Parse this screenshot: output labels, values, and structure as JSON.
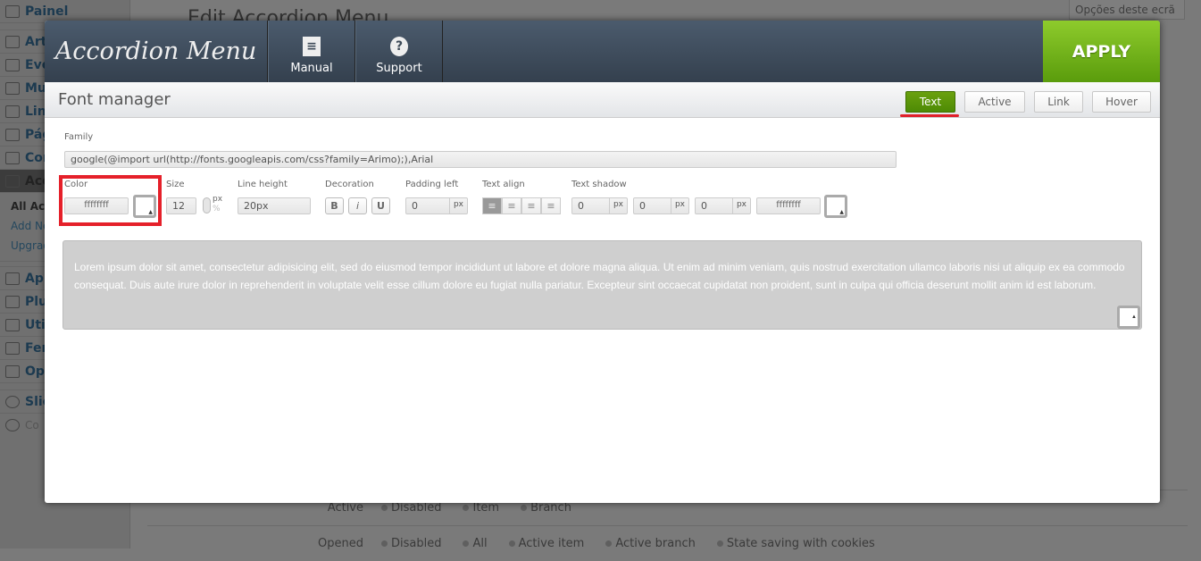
{
  "sidebar": {
    "items": [
      {
        "label": "Painel",
        "icon": "home-icon"
      },
      {
        "label": "Arti",
        "icon": "pin-icon"
      },
      {
        "label": "Eve",
        "icon": "calendar-icon"
      },
      {
        "label": "Mul",
        "icon": "media-icon"
      },
      {
        "label": "Lin",
        "icon": "link-icon"
      },
      {
        "label": "Pág",
        "icon": "pages-icon"
      },
      {
        "label": "Cor",
        "icon": "comments-icon"
      },
      {
        "label": "Acc",
        "icon": "accordion-icon",
        "current": true
      }
    ],
    "subitems": [
      "All Acc",
      "Add Ne",
      "Upgrad"
    ],
    "items2": [
      {
        "label": "Apr",
        "icon": "appearance-icon"
      },
      {
        "label": "Plu",
        "icon": "plugins-icon"
      },
      {
        "label": "Util",
        "icon": "users-icon"
      },
      {
        "label": "Fer",
        "icon": "tools-icon"
      },
      {
        "label": "Opç",
        "icon": "settings-icon"
      },
      {
        "label": "Slic",
        "icon": "gear-icon"
      },
      {
        "label": "Co",
        "icon": "collapse-icon"
      }
    ]
  },
  "page": {
    "title": "Edit Accordion Menu",
    "screen_options": "Opções deste ecrã ▾",
    "rows": [
      {
        "label": "Active",
        "options": [
          "Disabled",
          "Item",
          "Branch"
        ]
      },
      {
        "label": "Opened",
        "options": [
          "Disabled",
          "All",
          "Active item",
          "Active branch",
          "State saving with cookies"
        ]
      }
    ]
  },
  "modal": {
    "logo": "Accordion Menu",
    "manual": "Manual",
    "support": "Support",
    "apply": "APPLY",
    "title": "Font manager",
    "tabs": [
      "Text",
      "Active",
      "Link",
      "Hover"
    ],
    "active_tab": "Text",
    "family_label": "Family",
    "family_value": "google(@import url(http://fonts.googleapis.com/css?family=Arimo);),Arial",
    "color_label": "Color",
    "color_value": "ffffffff",
    "size_label": "Size",
    "size_value": "12",
    "unit_px": "px",
    "unit_pct": "%",
    "line_height_label": "Line height",
    "line_height_value": "20px",
    "decoration_label": "Decoration",
    "decoration": [
      "B",
      "i",
      "U"
    ],
    "padding_label": "Padding left",
    "padding_value": "0",
    "padding_unit": "px",
    "align_label": "Text align",
    "align_active": "left",
    "shadow_label": "Text shadow",
    "shadow": [
      "0",
      "0",
      "0"
    ],
    "shadow_unit": "px",
    "shadow_color": "ffffffff",
    "preview": "Lorem ipsum dolor sit amet, consectetur adipisicing elit, sed do eiusmod tempor incididunt ut labore et dolore magna aliqua. Ut enim ad minim veniam, quis nostrud exercitation ullamco laboris nisi ut aliquip ex ea commodo consequat. Duis aute irure dolor in reprehenderit in voluptate velit esse cillum dolore eu fugiat nulla pariatur. Excepteur sint occaecat cupidatat non proident, sunt in culpa qui officia deserunt mollit anim id est laborum.",
    "accent": "#5a9c0c",
    "highlight": "#e5202a"
  }
}
